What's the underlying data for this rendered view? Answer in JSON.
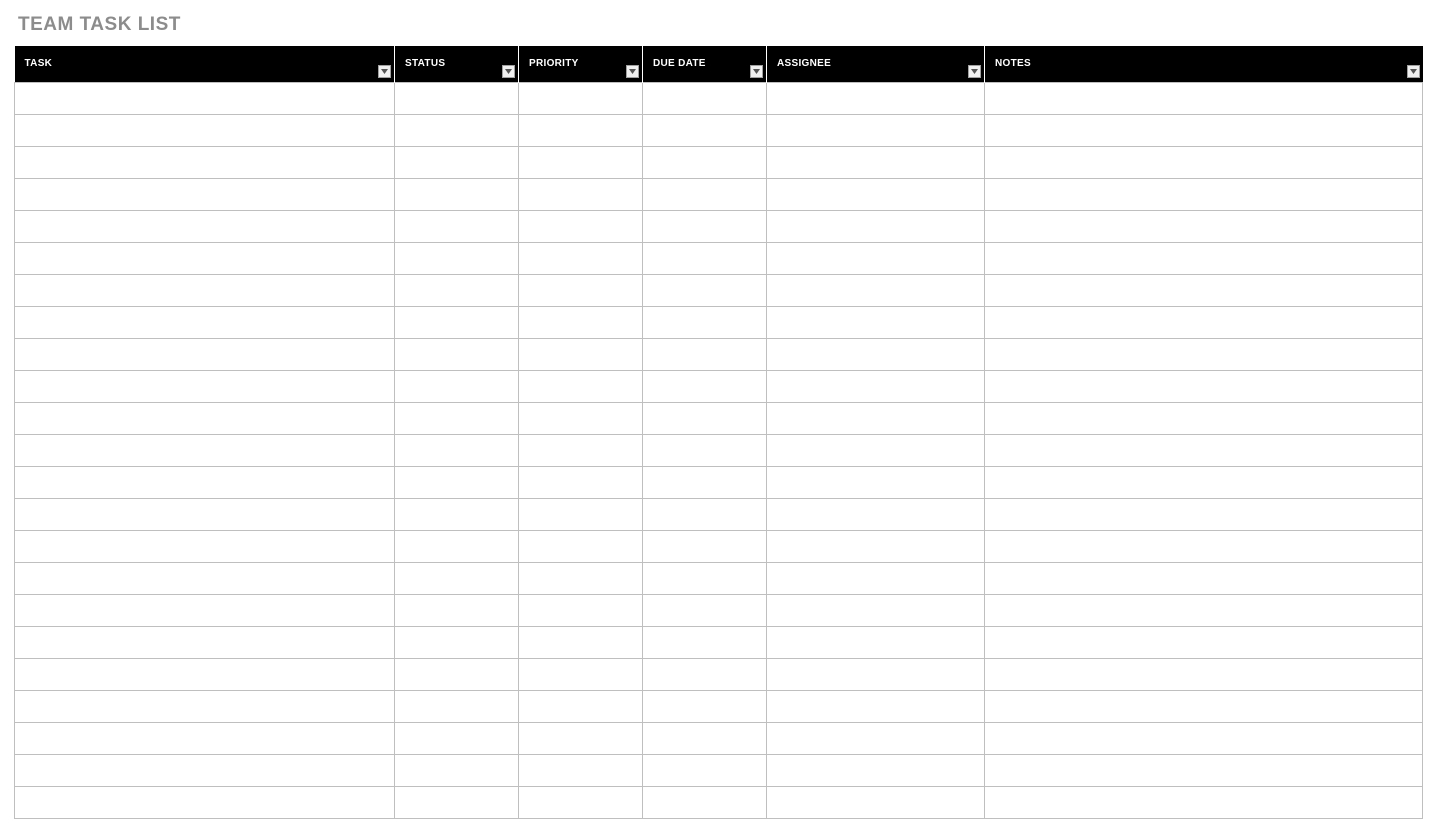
{
  "title": "TEAM TASK LIST",
  "columns": [
    {
      "label": "TASK",
      "width_class": "col-task"
    },
    {
      "label": "STATUS",
      "width_class": "col-status"
    },
    {
      "label": "PRIORITY",
      "width_class": "col-priority"
    },
    {
      "label": "DUE DATE",
      "width_class": "col-duedate"
    },
    {
      "label": "ASSIGNEE",
      "width_class": "col-assignee"
    },
    {
      "label": "NOTES",
      "width_class": "col-notes"
    }
  ],
  "row_count": 23
}
